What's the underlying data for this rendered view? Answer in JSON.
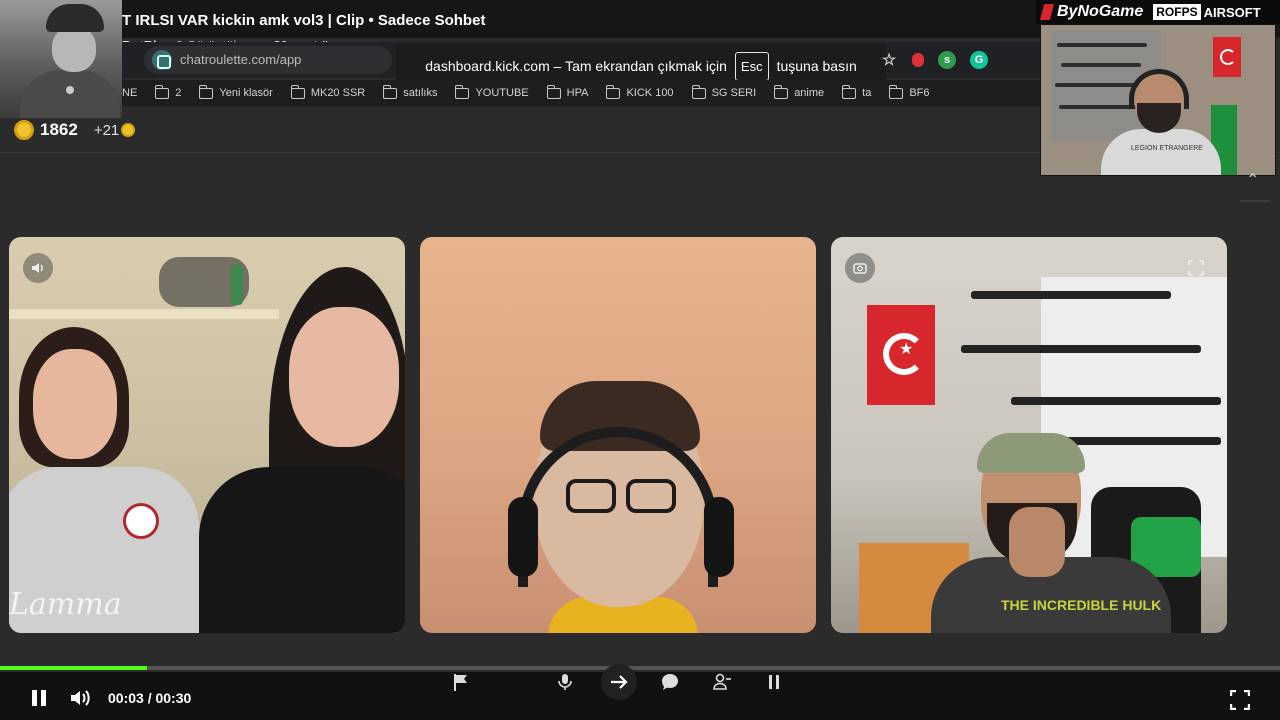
{
  "clip": {
    "title": "T IRLSI VAR kickin amk vol3 | Clip • Sadece Sohbet",
    "author": "BotRix",
    "views_sep": " • ",
    "views": "2 Görüntüleme",
    "age_sep": " • ",
    "age": "20 saat önce"
  },
  "browser": {
    "url": "chatroulette.com/app",
    "fullscreen_notice_prefix": "dashboard.kick.com – Tam ekrandan çıkmak için",
    "fullscreen_key": "Esc",
    "fullscreen_notice_suffix": "tuşuna basın",
    "bookmarks": [
      "NE",
      "2",
      "Yeni klasör",
      "MK20 SSR",
      "satılıks",
      "YOUTUBE",
      "HPA",
      "KICK 100",
      "SG SERI",
      "anime",
      "ta",
      "BF6"
    ],
    "extensions": [
      {
        "icon": "star-icon",
        "color": "#cfcfcf"
      },
      {
        "icon": "record-icon",
        "color": "#e0313b"
      },
      {
        "icon": "extension-s-icon",
        "color": "#2e9b4d",
        "label": "s"
      },
      {
        "icon": "grammarly-icon",
        "color": "#15c39a",
        "label": "G"
      }
    ]
  },
  "coins": {
    "balance": "1862",
    "bonus": "+21"
  },
  "overlay": {
    "brand": "ByNoGame",
    "sponsor_tag": "ROFPS",
    "sponsor_tag2": "AIRSOFT",
    "streamer_shirt_text": "LEGION ETRANGERE"
  },
  "tiles": [
    {
      "name": "remote-left",
      "icon": "speaker-icon",
      "shirt_text": "Lamma"
    },
    {
      "name": "remote-center"
    },
    {
      "name": "self-view",
      "icon_left": "camera-switch-icon",
      "icon_right": "fullscreen-icon",
      "shirt_text": "THE INCREDIBLE HULK"
    }
  ],
  "player": {
    "current_time": "00:03",
    "time_sep": " / ",
    "duration": "00:30",
    "progress": 0.115,
    "accent": "#53fc18"
  },
  "chat_controls": [
    "flag-icon",
    "microphone-icon",
    "next-arrow-icon",
    "chat-bubble-icon",
    "add-friend-icon",
    "pause-icon"
  ]
}
